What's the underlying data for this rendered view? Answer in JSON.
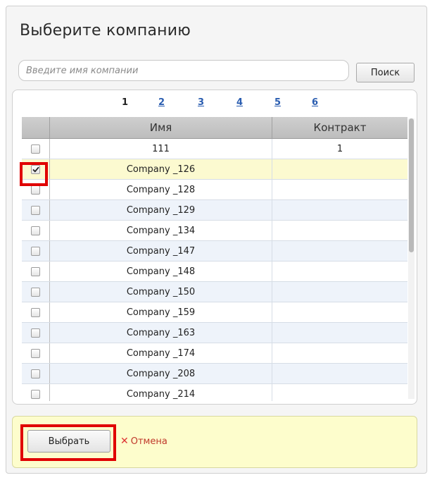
{
  "dialog": {
    "title": "Выберите компанию"
  },
  "search": {
    "placeholder": "Введите имя компании",
    "value": "",
    "button_label": "Поиск"
  },
  "pager": {
    "pages": [
      "1",
      "2",
      "3",
      "4",
      "5",
      "6"
    ],
    "current": "1"
  },
  "table": {
    "columns": [
      "",
      "Имя",
      "Контракт"
    ],
    "rows": [
      {
        "checked": false,
        "name": "111",
        "contract": "1"
      },
      {
        "checked": true,
        "name": "Company _126",
        "contract": ""
      },
      {
        "checked": false,
        "name": "Company _128",
        "contract": ""
      },
      {
        "checked": false,
        "name": "Company _129",
        "contract": ""
      },
      {
        "checked": false,
        "name": "Company _134",
        "contract": ""
      },
      {
        "checked": false,
        "name": "Company _147",
        "contract": ""
      },
      {
        "checked": false,
        "name": "Company _148",
        "contract": ""
      },
      {
        "checked": false,
        "name": "Company _150",
        "contract": ""
      },
      {
        "checked": false,
        "name": "Company _159",
        "contract": ""
      },
      {
        "checked": false,
        "name": "Company _163",
        "contract": ""
      },
      {
        "checked": false,
        "name": "Company _174",
        "contract": ""
      },
      {
        "checked": false,
        "name": "Company _208",
        "contract": ""
      },
      {
        "checked": false,
        "name": "Company _214",
        "contract": ""
      }
    ]
  },
  "footer": {
    "select_label": "Выбрать",
    "cancel_label": "Отмена"
  },
  "colors": {
    "selected_row": "#fcfad0",
    "alt_row": "#eef3fa",
    "footer_bg": "#fdfdcc",
    "highlight": "#e00000",
    "link": "#2a5db0",
    "cancel": "#c0392b"
  }
}
